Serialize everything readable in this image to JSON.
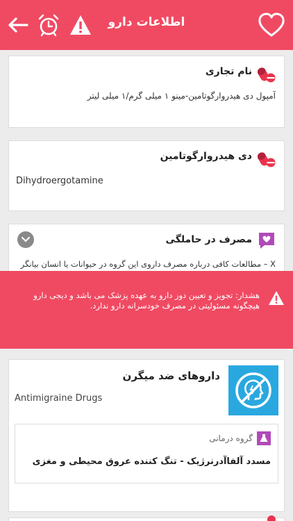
{
  "header": {
    "title": "اطلاعات دارو",
    "icons": [
      "back-arrow-icon",
      "alarm-clock-icon",
      "warning-icon",
      "heart-icon"
    ],
    "accent": "#f04a63"
  },
  "brand_card": {
    "title": "نام تجاری",
    "text": "آمپول دی هیدروارگوتامین-مینو ۱ میلی گرم/۱ میلی لیتر"
  },
  "generic_card": {
    "title": "دی هیدروارگوتامین",
    "text": "Dihydroergotamine"
  },
  "pregnancy_card": {
    "title": "مصرف در حاملگی",
    "text": "X –  مطالعات کافی درباره  مصرف داروی این گروه در حیوانات یا انسان بیانگر"
  },
  "warning": {
    "text": "هشدار: تجویز و تعیین دوز دارو به عهده پزشک می باشد و دیجی دارو هیچگونه مسئولیتی در مصرف خودسرانه دارو ندارد."
  },
  "drug_class": {
    "title_fa": "داروهای ضد میگرن",
    "title_en": "Antimigraine Drugs",
    "group_label": "گروه درمانی",
    "group_value": "مسدد آلفاآدرنرژیک - تنگ کننده عروق محیطی و مغزی",
    "image_color": "#29a8e0"
  }
}
